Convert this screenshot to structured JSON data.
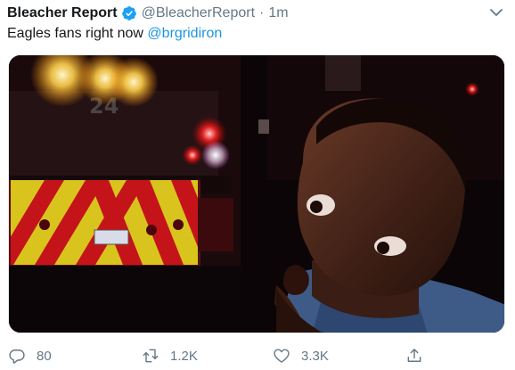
{
  "tweet": {
    "display_name": "Bleacher Report",
    "verified": true,
    "handle": "@BleacherReport",
    "separator": "·",
    "timestamp": "1m",
    "text": "Eagles fans right now ",
    "mention": "@brgridiron",
    "media": {
      "truck_number": "24"
    }
  },
  "actions": {
    "reply_count": "80",
    "retweet_count": "1.2K",
    "like_count": "3.3K"
  },
  "colors": {
    "text": "#14171a",
    "secondary": "#657786",
    "link": "#1b95e0",
    "verified": "#1da1f2"
  },
  "icons": [
    "verified-badge-icon",
    "chevron-down-icon",
    "reply-icon",
    "retweet-icon",
    "like-icon",
    "share-icon"
  ]
}
